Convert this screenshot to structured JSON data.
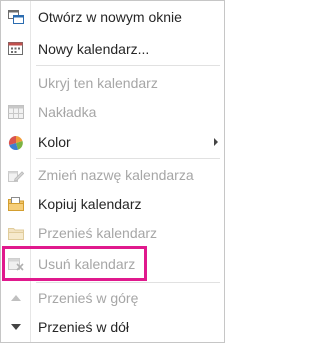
{
  "menu": {
    "items": [
      {
        "label": "Otwórz w nowym oknie",
        "icon": "new-window-icon",
        "enabled": true
      },
      {
        "label": "Nowy kalendarz...",
        "icon": "new-calendar-icon",
        "enabled": true
      },
      {
        "label": "Ukryj ten kalendarz",
        "icon": "",
        "enabled": false
      },
      {
        "label": "Nakładka",
        "icon": "overlay-icon",
        "enabled": false
      },
      {
        "label": "Kolor",
        "icon": "color-icon",
        "enabled": true,
        "has_submenu": true
      },
      {
        "label": "Zmień nazwę kalendarza",
        "icon": "rename-icon",
        "enabled": false
      },
      {
        "label": "Kopiuj kalendarz",
        "icon": "copy-icon",
        "enabled": true
      },
      {
        "label": "Przenieś kalendarz",
        "icon": "move-icon",
        "enabled": false
      },
      {
        "label": "Usuń kalendarz",
        "icon": "delete-icon",
        "enabled": false,
        "highlighted": true
      },
      {
        "label": "Przenieś w górę",
        "icon": "move-up-icon",
        "enabled": false
      },
      {
        "label": "Przenieś w dół",
        "icon": "move-down-icon",
        "enabled": true
      }
    ]
  },
  "colors": {
    "text": "#262626",
    "disabled_text": "#a6a6a6",
    "highlight_border": "#e0198d"
  }
}
